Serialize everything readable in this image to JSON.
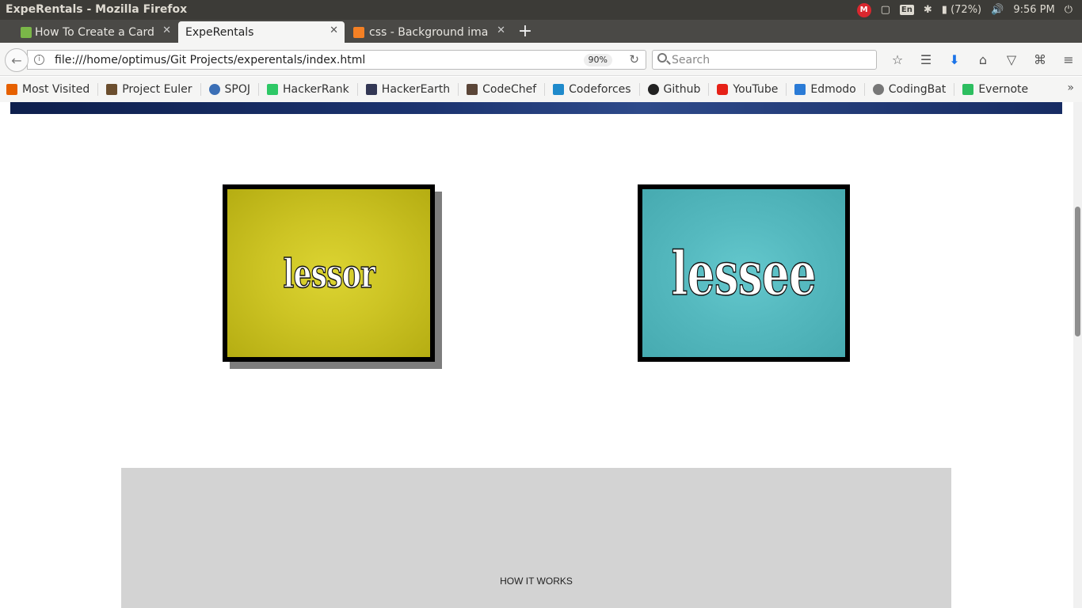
{
  "os": {
    "window_title": "ExpeRentals - Mozilla Firefox",
    "battery": "(72%)",
    "time": "9:56 PM",
    "language": "En",
    "mega_label": "M"
  },
  "tabs": [
    {
      "label": "How To Create a Card v",
      "active": false
    },
    {
      "label": "ExpeRentals",
      "active": true
    },
    {
      "label": "css - Background imag",
      "active": false
    }
  ],
  "navbar": {
    "url": "file:///home/optimus/Git Projects/experentals/index.html",
    "zoom": "90%",
    "search_placeholder": "Search"
  },
  "bookmarks": [
    {
      "label": "Most Visited",
      "color": "#e66000"
    },
    {
      "label": "Project Euler",
      "color": "#6b4e2e"
    },
    {
      "label": "SPOJ",
      "color": "#3b6fb6"
    },
    {
      "label": "HackerRank",
      "color": "#2ec866"
    },
    {
      "label": "HackerEarth",
      "color": "#323754"
    },
    {
      "label": "CodeChef",
      "color": "#5b4638"
    },
    {
      "label": "Codeforces",
      "color": "#1f8acb"
    },
    {
      "label": "Github",
      "color": "#222222"
    },
    {
      "label": "YouTube",
      "color": "#e62117"
    },
    {
      "label": "Edmodo",
      "color": "#2b7bd6"
    },
    {
      "label": "CodingBat",
      "color": "#777777"
    },
    {
      "label": "Evernote",
      "color": "#2dbe60"
    }
  ],
  "page": {
    "lessor_card": "lessor",
    "lessee_card": "lessee",
    "how_it_works": "HOW IT WORKS"
  }
}
